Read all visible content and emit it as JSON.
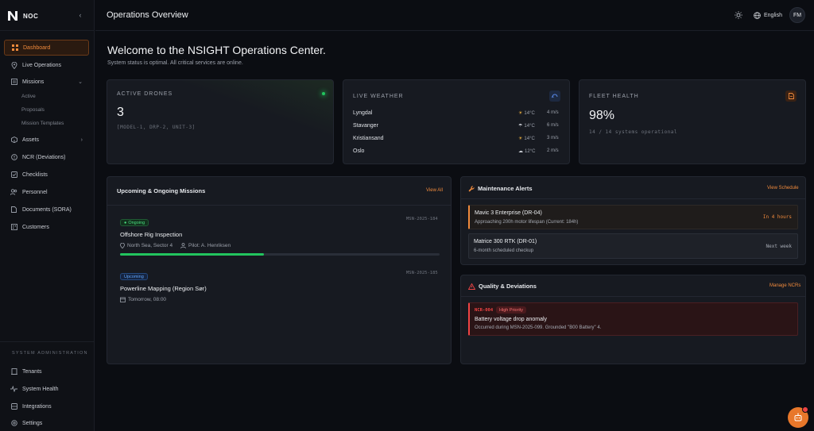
{
  "sidebar": {
    "brand": "NOC",
    "items": [
      {
        "label": "Dashboard",
        "icon": "grid-icon",
        "active": true
      },
      {
        "label": "Live Operations",
        "icon": "map-pin-icon"
      },
      {
        "label": "Missions",
        "icon": "clipboard-icon"
      },
      {
        "label": "Assets",
        "icon": "box-icon"
      },
      {
        "label": "NCR (Deviations)",
        "icon": "alert-circle-icon"
      },
      {
        "label": "Checklists",
        "icon": "checklist-icon"
      },
      {
        "label": "Personnel",
        "icon": "users-icon"
      },
      {
        "label": "Documents (SORA)",
        "icon": "document-icon"
      },
      {
        "label": "Customers",
        "icon": "building-icon"
      }
    ],
    "mission_sub": [
      "Active",
      "Proposals",
      "Mission Templates"
    ],
    "admin_label": "SYSTEM ADMINISTRATION",
    "admin_items": [
      {
        "label": "Tenants",
        "icon": "building-icon"
      },
      {
        "label": "System Health",
        "icon": "activity-icon"
      },
      {
        "label": "Integrations",
        "icon": "database-icon"
      },
      {
        "label": "Settings",
        "icon": "gear-icon"
      }
    ]
  },
  "header": {
    "title": "Operations Overview",
    "language": "English",
    "avatar_initials": "FM"
  },
  "welcome": {
    "title": "Welcome to the NSIGHT Operations Center.",
    "subtitle": "System status is optimal. All critical services are online."
  },
  "active_drones": {
    "label": "ACTIVE DRONES",
    "value": "3",
    "meta": "[MODEL-1, DRP-2, UNIT-3]"
  },
  "live_weather": {
    "label": "LIVE WEATHER",
    "rows": [
      {
        "city": "Lyngdal",
        "temp": "14°C",
        "wind": "4 m/s",
        "icon": "sun-icon"
      },
      {
        "city": "Stavanger",
        "temp": "14°C",
        "wind": "6 m/s",
        "icon": "cloud-rain-icon"
      },
      {
        "city": "Kristiansand",
        "temp": "14°C",
        "wind": "3 m/s",
        "icon": "sun-icon"
      },
      {
        "city": "Oslo",
        "temp": "12°C",
        "wind": "2 m/s",
        "icon": "cloud-icon"
      }
    ]
  },
  "fleet_health": {
    "label": "FLEET HEALTH",
    "value": "98%",
    "meta": "14 / 14 systems operational"
  },
  "missions_panel": {
    "title": "Upcoming & Ongoing Missions",
    "view_all": "View All",
    "missions": [
      {
        "badge": "Ongoing",
        "id": "MSN-2025-184",
        "title": "Offshore Rig Inspection",
        "location": "North Sea, Sector 4",
        "pilot": "Pilot: A. Henriksen",
        "progress": 0.45
      },
      {
        "badge": "Upcoming",
        "id": "MSN-2025-185",
        "title": "Powerline Mapping (Region Sør)",
        "time": "Tomorrow, 08:00"
      }
    ]
  },
  "maintenance": {
    "title": "Maintenance Alerts",
    "link": "View Schedule",
    "alerts": [
      {
        "title": "Mavic 3 Enterprise (DR-04)",
        "desc": "Approaching 200h motor lifespan (Current: 184h)",
        "right": "In 4 hours"
      },
      {
        "title": "Matrice 300 RTK (DR-01)",
        "desc": "6-month scheduled checkup",
        "right": "Next week"
      }
    ]
  },
  "quality": {
    "title": "Quality & Deviations",
    "link": "Manage NCRs",
    "item": {
      "id": "NCR-004",
      "severity": "High Priority",
      "title": "Battery voltage drop anomaly",
      "desc": "Occurred during MSN-2025-099. Grounded \"B00 Battery\" 4."
    }
  },
  "colors": {
    "accent": "#f08a3c",
    "success": "#22c55e",
    "danger": "#ef4444",
    "info": "#3b82f6"
  }
}
